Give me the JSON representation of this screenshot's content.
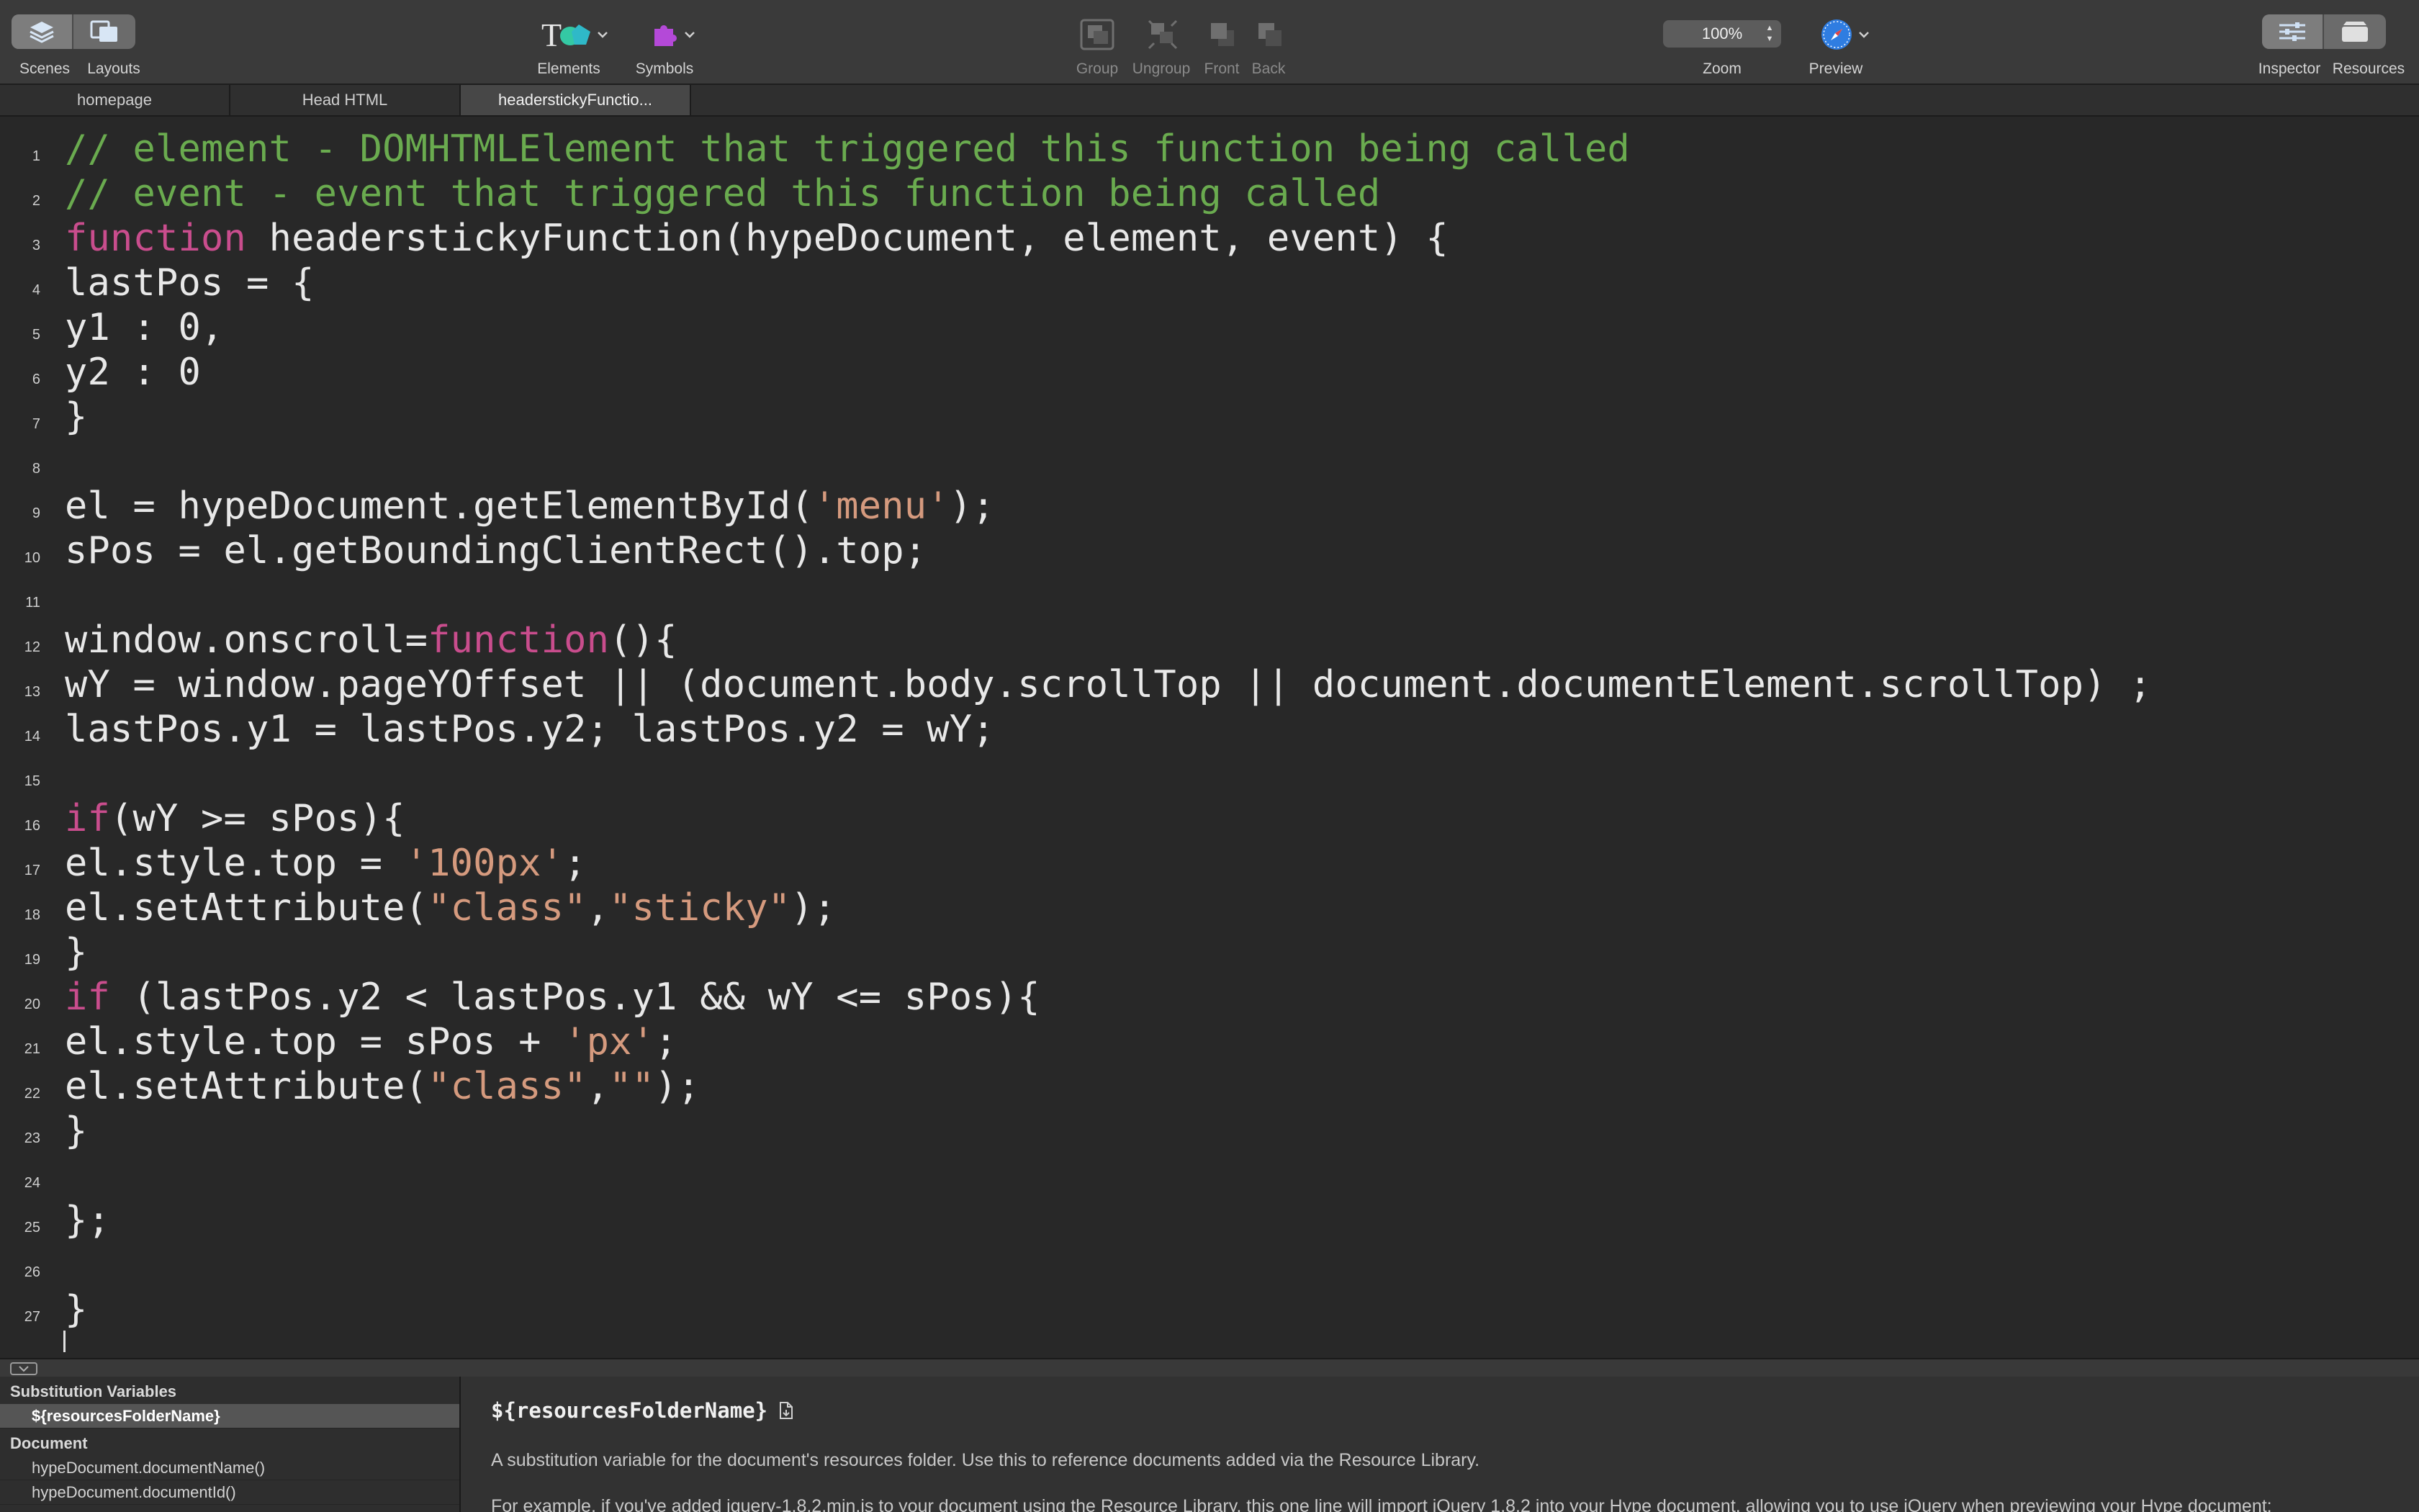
{
  "toolbar": {
    "scenes_label": "Scenes",
    "layouts_label": "Layouts",
    "elements_label": "Elements",
    "symbols_label": "Symbols",
    "group_label": "Group",
    "ungroup_label": "Ungroup",
    "front_label": "Front",
    "back_label": "Back",
    "zoom_value": "100%",
    "zoom_label": "Zoom",
    "preview_label": "Preview",
    "inspector_label": "Inspector",
    "resources_label": "Resources",
    "elements_icon_text": "T"
  },
  "tabs": [
    {
      "label": "homepage"
    },
    {
      "label": "Head HTML"
    },
    {
      "label": "headerstickyFunctio..."
    }
  ],
  "editor": {
    "lines": [
      {
        "n": "1",
        "tokens": [
          {
            "t": "comment",
            "v": "// element - DOMHTMLElement that triggered this function being called"
          }
        ]
      },
      {
        "n": "2",
        "tokens": [
          {
            "t": "comment",
            "v": "// event - event that triggered this function being called"
          }
        ]
      },
      {
        "n": "3",
        "tokens": [
          {
            "t": "keyword",
            "v": "function"
          },
          {
            "t": "plain",
            "v": " headerstickyFunction(hypeDocument, element, event) {"
          }
        ]
      },
      {
        "n": "4",
        "tokens": [
          {
            "t": "plain",
            "v": "lastPos = {"
          }
        ]
      },
      {
        "n": "5",
        "tokens": [
          {
            "t": "plain",
            "v": "y1 : 0,"
          }
        ]
      },
      {
        "n": "6",
        "tokens": [
          {
            "t": "plain",
            "v": "y2 : 0"
          }
        ]
      },
      {
        "n": "7",
        "tokens": [
          {
            "t": "plain",
            "v": "}"
          }
        ]
      },
      {
        "n": "8",
        "tokens": []
      },
      {
        "n": "9",
        "tokens": [
          {
            "t": "plain",
            "v": "el = hypeDocument.getElementById("
          },
          {
            "t": "string",
            "v": "'menu'"
          },
          {
            "t": "plain",
            "v": ");"
          }
        ]
      },
      {
        "n": "10",
        "tokens": [
          {
            "t": "plain",
            "v": "sPos = el.getBoundingClientRect().top;"
          }
        ]
      },
      {
        "n": "11",
        "tokens": []
      },
      {
        "n": "12",
        "tokens": [
          {
            "t": "plain",
            "v": "window.onscroll="
          },
          {
            "t": "keyword",
            "v": "function"
          },
          {
            "t": "plain",
            "v": "(){"
          }
        ]
      },
      {
        "n": "13",
        "tokens": [
          {
            "t": "plain",
            "v": "wY = window.pageYOffset || (document.body.scrollTop || document.documentElement.scrollTop) ;"
          }
        ]
      },
      {
        "n": "14",
        "tokens": [
          {
            "t": "plain",
            "v": "lastPos.y1 = lastPos.y2; lastPos.y2 = wY;"
          }
        ]
      },
      {
        "n": "15",
        "tokens": []
      },
      {
        "n": "16",
        "tokens": [
          {
            "t": "keyword",
            "v": "if"
          },
          {
            "t": "plain",
            "v": "(wY >= sPos){"
          }
        ]
      },
      {
        "n": "17",
        "tokens": [
          {
            "t": "plain",
            "v": "el.style.top = "
          },
          {
            "t": "string",
            "v": "'100px'"
          },
          {
            "t": "plain",
            "v": ";"
          }
        ]
      },
      {
        "n": "18",
        "tokens": [
          {
            "t": "plain",
            "v": "el.setAttribute("
          },
          {
            "t": "string",
            "v": "\"class\""
          },
          {
            "t": "plain",
            "v": ","
          },
          {
            "t": "string",
            "v": "\"sticky\""
          },
          {
            "t": "plain",
            "v": ");"
          }
        ]
      },
      {
        "n": "19",
        "tokens": [
          {
            "t": "plain",
            "v": "}"
          }
        ]
      },
      {
        "n": "20",
        "tokens": [
          {
            "t": "keyword",
            "v": "if"
          },
          {
            "t": "plain",
            "v": " (lastPos.y2 < lastPos.y1 && wY <= sPos){"
          }
        ]
      },
      {
        "n": "21",
        "tokens": [
          {
            "t": "plain",
            "v": "el.style.top = sPos + "
          },
          {
            "t": "string",
            "v": "'px'"
          },
          {
            "t": "plain",
            "v": ";"
          }
        ]
      },
      {
        "n": "22",
        "tokens": [
          {
            "t": "plain",
            "v": "el.setAttribute("
          },
          {
            "t": "string",
            "v": "\"class\""
          },
          {
            "t": "plain",
            "v": ","
          },
          {
            "t": "string",
            "v": "\"\""
          },
          {
            "t": "plain",
            "v": ");"
          }
        ]
      },
      {
        "n": "23",
        "tokens": [
          {
            "t": "plain",
            "v": "}"
          }
        ]
      },
      {
        "n": "24",
        "tokens": []
      },
      {
        "n": "25",
        "tokens": [
          {
            "t": "plain",
            "v": "};"
          }
        ]
      },
      {
        "n": "26",
        "tokens": []
      },
      {
        "n": "27",
        "tokens": [
          {
            "t": "plain",
            "v": "}"
          }
        ]
      }
    ]
  },
  "sidebar": {
    "section1_title": "Substitution Variables",
    "section1_items": [
      {
        "label": "${resourcesFolderName}",
        "selected": true
      }
    ],
    "section2_title": "Document",
    "section2_items": [
      {
        "label": "hypeDocument.documentName()"
      },
      {
        "label": "hypeDocument.documentId()"
      }
    ]
  },
  "doc": {
    "title": "${resourcesFolderName}",
    "description": "A substitution variable for the document's resources folder. Use this to reference documents added via the Resource Library.",
    "example": "For example, if you've added jquery-1.8.2.min.js to your document using the Resource Library, this one line will import jQuery 1.8.2 into your Hype document, allowing you to use jQuery when previewing your Hype document:"
  },
  "colors": {
    "comment": "#6aab4f",
    "keyword": "#c94d8d",
    "string": "#d59a7e",
    "plain": "#e8e8e8",
    "preview_accent": "#2f7de1",
    "elements_accent": "#34c9a4",
    "symbols_accent": "#b449d8"
  }
}
